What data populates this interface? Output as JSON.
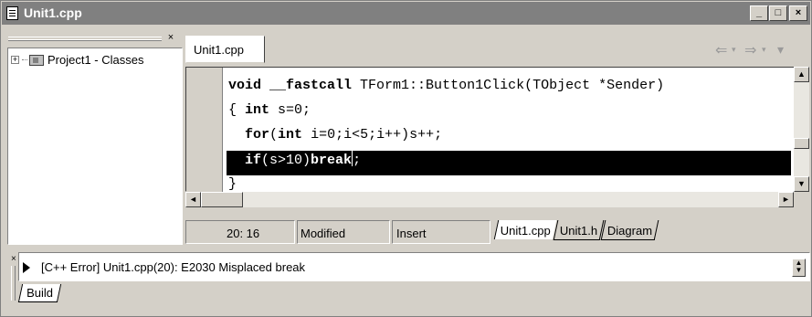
{
  "window": {
    "title": "Unit1.cpp",
    "controls": {
      "minimize": "_",
      "maximize": "□",
      "close": "×"
    }
  },
  "class_explorer": {
    "close": "×",
    "tree": [
      {
        "expander": "+",
        "icon": "project-icon",
        "label": "Project1 - Classes"
      }
    ]
  },
  "editor": {
    "tab_label": "Unit1.cpp",
    "nav": {
      "back": "⇐",
      "forward": "⇒",
      "dropdown": "▾"
    },
    "code_lines": [
      {
        "parts": [
          {
            "t": "void",
            "b": true
          },
          {
            "t": " "
          },
          {
            "t": "__fastcall",
            "b": true
          },
          {
            "t": " TForm1::Button1Click(TObject *Sender)"
          }
        ]
      },
      {
        "parts": [
          {
            "t": "{ "
          },
          {
            "t": "int",
            "b": true
          },
          {
            "t": " s=0;"
          }
        ]
      },
      {
        "parts": [
          {
            "t": "  "
          },
          {
            "t": "for",
            "b": true
          },
          {
            "t": "("
          },
          {
            "t": "int",
            "b": true
          },
          {
            "t": " i=0;i<5;i++)s++;"
          }
        ]
      },
      {
        "selected": true,
        "parts": [
          {
            "t": "  "
          },
          {
            "t": "if",
            "b": true
          },
          {
            "t": "(s>10)"
          },
          {
            "t": "break",
            "b": true
          },
          {
            "t": ";",
            "caret_before": true
          }
        ]
      },
      {
        "parts": [
          {
            "t": "}"
          }
        ]
      }
    ]
  },
  "scrollbars": {
    "up": "▲",
    "down": "▼",
    "left": "◄",
    "right": "►"
  },
  "status": {
    "position": "20: 16",
    "modified": "Modified",
    "mode": "Insert",
    "file_tabs": [
      "Unit1.cpp",
      "Unit1.h",
      "Diagram"
    ],
    "active_file_tab": "Unit1.cpp"
  },
  "messages": {
    "close": "×",
    "items": [
      "[C++ Error] Unit1.cpp(20): E2030 Misplaced break"
    ],
    "spin": {
      "up": "▲",
      "down": "▼"
    },
    "tabs": [
      "Build"
    ]
  }
}
